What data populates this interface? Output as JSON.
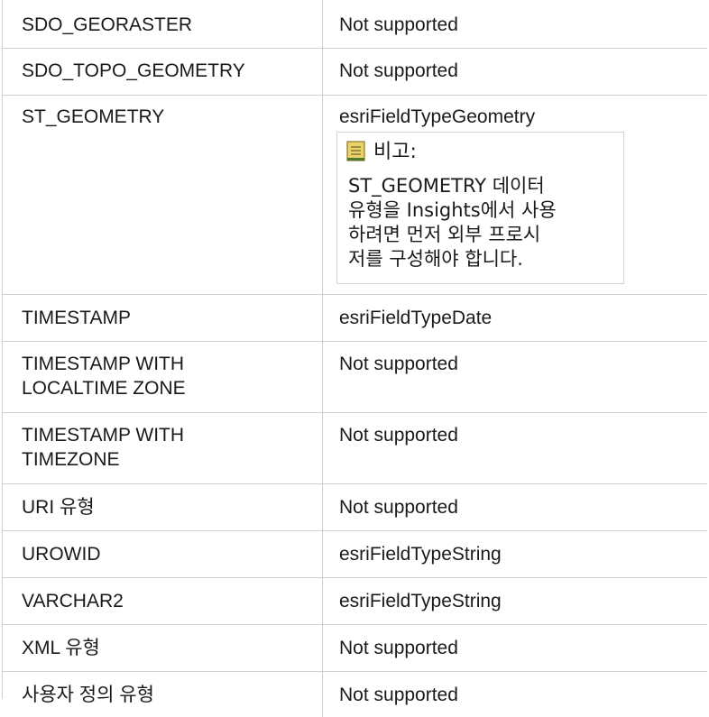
{
  "rows": [
    {
      "type": "SDO_GEORASTER",
      "mapping": "Not supported"
    },
    {
      "type": "SDO_TOPO_GEOMETRY",
      "mapping": "Not supported"
    },
    {
      "type": "ST_GEOMETRY",
      "mapping": "esriFieldTypeGeometry"
    },
    {
      "type": "TIMESTAMP",
      "mapping": "esriFieldTypeDate"
    },
    {
      "type": "TIMESTAMP WITH\nLOCALTIME ZONE",
      "mapping": "Not supported"
    },
    {
      "type": "TIMESTAMP WITH\nTIMEZONE",
      "mapping": "Not supported"
    },
    {
      "type": "URI 유형",
      "mapping": "Not supported"
    },
    {
      "type": "UROWID",
      "mapping": "esriFieldTypeString"
    },
    {
      "type": "VARCHAR2",
      "mapping": "esriFieldTypeString"
    },
    {
      "type": "XML 유형",
      "mapping": "Not supported"
    },
    {
      "type": "사용자 정의 유형",
      "mapping": "Not supported"
    }
  ],
  "note": {
    "icon": "note-icon",
    "title": "비고:",
    "body": "ST_GEOMETRY 데이터\n유형을 Insights에서 사용\n하려면 먼저 외부 프로시\n저를 구성해야 합니다."
  },
  "colors": {
    "border": "#cfcfcf",
    "note_icon": "#e8c95a"
  }
}
